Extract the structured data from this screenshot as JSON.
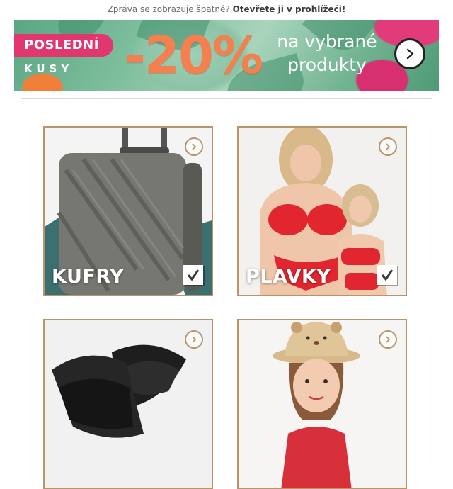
{
  "preheader": {
    "text": "Zpráva se zobrazuje špatně?",
    "link": "Otevřete ji v prohlížeči!"
  },
  "banner": {
    "tag": "POSLEDNÍ",
    "sub_tag": "KUSY",
    "discount": "-20%",
    "text_line1": "na vybrané",
    "text_line2": "produkty",
    "cta_icon": "chevron-right-circle-icon",
    "colors": {
      "tag": "#e1366f",
      "discount": "#f5804f",
      "background": "#6fb28f"
    }
  },
  "categories": [
    {
      "label": "KUFRY",
      "icon": "checkmark-icon"
    },
    {
      "label": "PLAVKY",
      "icon": "checkmark-icon"
    },
    {
      "label": "",
      "icon": "arrow-circle-icon"
    },
    {
      "label": "",
      "icon": "arrow-circle-icon"
    }
  ],
  "colors": {
    "card_border": "#b9936a"
  }
}
